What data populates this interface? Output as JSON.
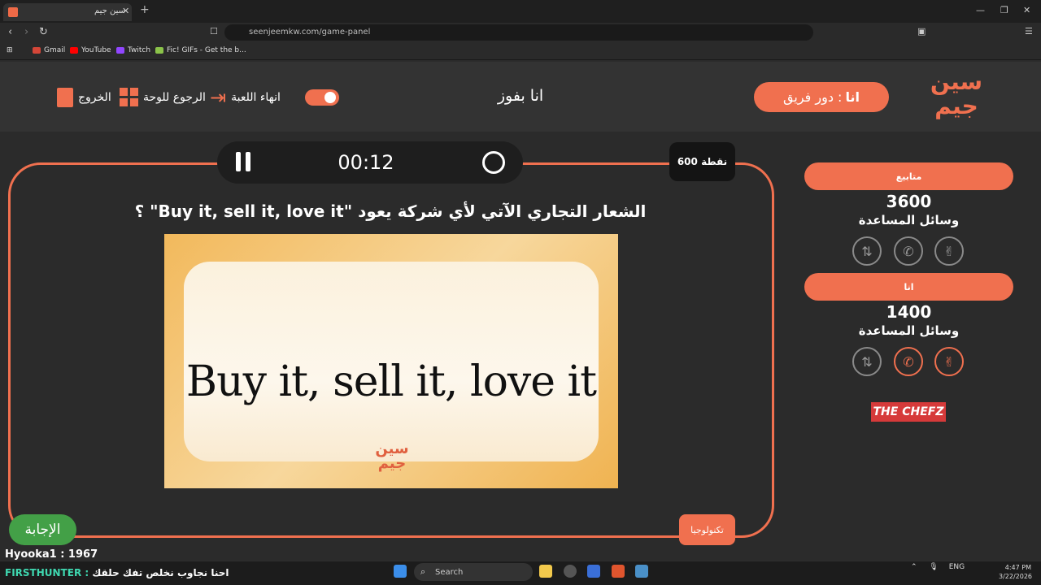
{
  "browser": {
    "tab_title": "سين جيم",
    "tab_close": "✕",
    "new_tab": "+",
    "url": "seenjeemkw.com/game-panel",
    "bookmarks": [
      {
        "label": "Gmail",
        "color": "#d44638"
      },
      {
        "label": "YouTube",
        "color": "#ff0000"
      },
      {
        "label": "Twitch",
        "color": "#9146ff"
      },
      {
        "label": "Fic! GIFs - Get the b...",
        "color": "#8bc34a"
      }
    ]
  },
  "header": {
    "exit_label": "الخروج",
    "back_to_board_label": "الرجوع للوحة",
    "end_game_label": "انهاء اللعبة",
    "center_title": "انا بفوز",
    "turn_label": "دور فريق :",
    "turn_team": "انا",
    "logo_text": "سين جيم"
  },
  "question": {
    "timer": "00:12",
    "points": "600 نقطة",
    "text": "الشعار التجاري الآتي لأي شركة يعود \"Buy it, sell it, love it\" ؟",
    "image_slogan": "Buy it, sell it, love it",
    "image_logo": "سين جيم",
    "category": "تكنولوجيا",
    "answer_button": "الإجابة"
  },
  "teams": [
    {
      "name": "متابيع",
      "score": "3600",
      "aids_label": "وسائل المساعدة",
      "aids": [
        {
          "icon": "two-answers-icon",
          "glyph": "✌",
          "active": false
        },
        {
          "icon": "call-icon",
          "glyph": "✆",
          "active": false
        },
        {
          "icon": "swap-icon",
          "glyph": "⇅",
          "active": false
        }
      ]
    },
    {
      "name": "انا",
      "score": "1400",
      "aids_label": "وسائل المساعدة",
      "aids": [
        {
          "icon": "two-answers-icon",
          "glyph": "✌",
          "active": true
        },
        {
          "icon": "call-icon",
          "glyph": "✆",
          "active": true
        },
        {
          "icon": "swap-icon",
          "glyph": "⇅",
          "active": false
        }
      ]
    }
  ],
  "sponsor": "THE CHEFZ",
  "chat": {
    "line1": "Hyooka1 : 1967",
    "line2_name": "FIRSTHUNTER :",
    "line2_msg": "احنا نجاوب نخلص تفك حلقك"
  },
  "taskbar": {
    "search_placeholder": "Search",
    "lang": "ENG",
    "time": "4:47 PM",
    "date": "3/22/2026"
  },
  "colors": {
    "accent": "#f0704f",
    "answer": "#43a047",
    "background": "#2b2b2b",
    "header_bg": "#333333"
  }
}
